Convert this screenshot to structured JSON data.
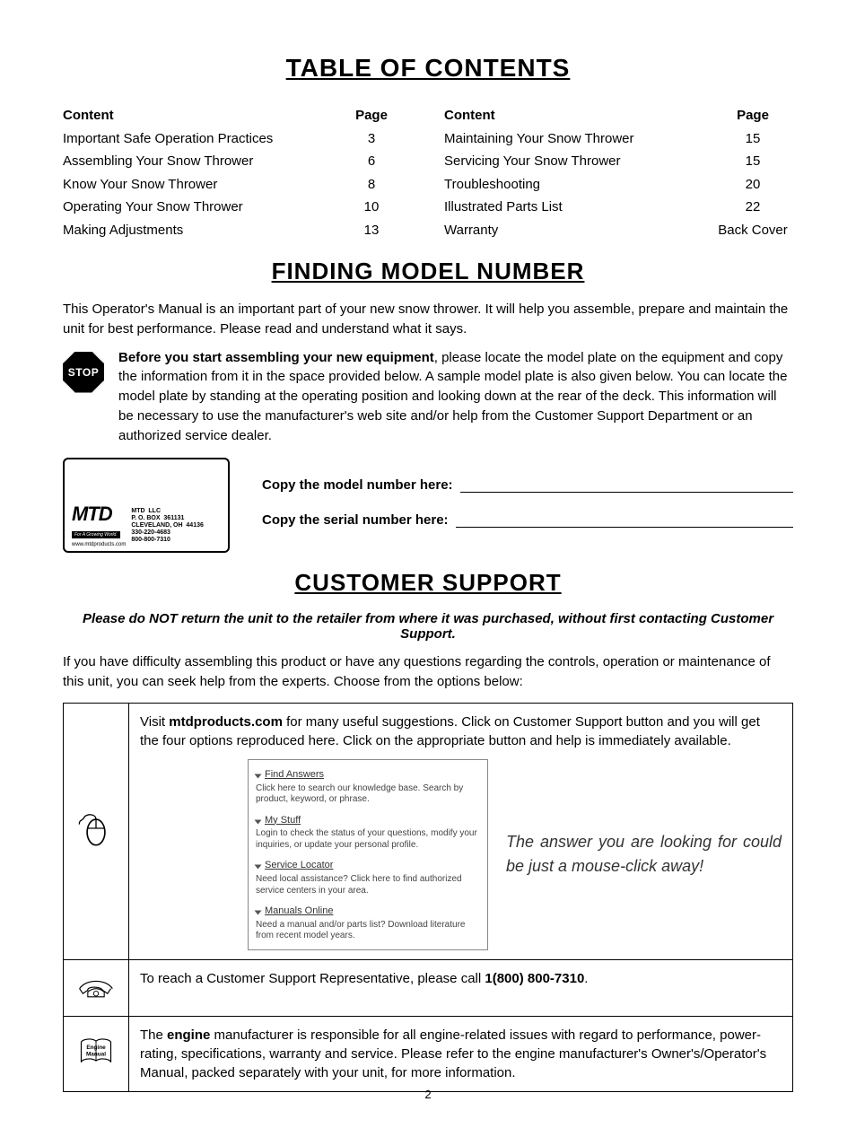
{
  "headings": {
    "toc": "TABLE OF CONTENTS",
    "model": "FINDING MODEL NUMBER",
    "support": "CUSTOMER SUPPORT"
  },
  "toc_header": {
    "content": "Content",
    "page": "Page"
  },
  "toc_left": [
    {
      "label": "Important Safe Operation Practices",
      "page": "3"
    },
    {
      "label": "Assembling Your Snow Thrower",
      "page": "6"
    },
    {
      "label": "Know Your Snow Thrower",
      "page": "8"
    },
    {
      "label": "Operating Your Snow Thrower",
      "page": "10"
    },
    {
      "label": "Making Adjustments",
      "page": "13"
    }
  ],
  "toc_right": [
    {
      "label": "Maintaining Your Snow Thrower",
      "page": "15"
    },
    {
      "label": "Servicing Your Snow Thrower",
      "page": "15"
    },
    {
      "label": "Troubleshooting",
      "page": "20"
    },
    {
      "label": "Illustrated Parts List",
      "page": "22"
    },
    {
      "label": "Warranty",
      "page": "Back Cover"
    }
  ],
  "model": {
    "intro": "This Operator's Manual is an important part of your new snow thrower. It will help you assemble, prepare and maintain the unit for best performance. Please read and understand what it says.",
    "stop_label": "STOP",
    "stop_text_bold": "Before you start assembling your new equipment",
    "stop_text_rest": ", please locate the model plate on the equipment and copy the information from it in the space provided below. A sample model plate is also given below. You can locate the model plate by standing at the operating position and looking down at the rear of the deck. This information will be necessary to use the manufacturer's web site and/or help from the Customer Support Department or an authorized service dealer.",
    "copy_model": "Copy the model number here:",
    "copy_serial": "Copy the serial number here:",
    "plate": {
      "brand": "MTD",
      "tag": "For A Growing World.",
      "url": "www.mtdproducts.com",
      "addr": "MTD  LLC\nP. O. BOX  361131\nCLEVELAND, OH  44136\n330-220-4683\n800-800-7310"
    }
  },
  "support": {
    "warn": "Please do NOT return the unit to the retailer from where it was purchased, without first contacting Customer Support.",
    "intro": "If you have difficulty assembling this product or have any questions regarding the controls, operation or maintenance of this unit, you can seek help from the experts. Choose from the options below:",
    "web_pre": "Visit ",
    "web_site": "mtdproducts.com",
    "web_post": " for many useful suggestions. Click on Customer Support button and you will get the four options reproduced here. Click on the appropriate button and help is immediately available.",
    "answer_callout": "The answer you are looking for could be just a mouse-click away!",
    "options": {
      "find": {
        "title": "Find Answers",
        "desc": "Click here to search our knowledge base. Search by product, keyword, or phrase."
      },
      "mystuff": {
        "title": "My Stuff",
        "desc": "Login to check the status of your questions, modify your inquiries, or update your personal profile."
      },
      "locator": {
        "title": "Service Locator",
        "desc": "Need local assistance? Click here to find authorized service centers in your area."
      },
      "manuals": {
        "title": "Manuals Online",
        "desc": "Need a manual and/or parts list? Download literature from recent model years."
      }
    },
    "phone_pre": "To reach a Customer Support Representative, please call ",
    "phone_num": "1(800) 800-7310",
    "phone_post": ".",
    "engine_icon_label": "Engine\nManual",
    "engine_pre": "The ",
    "engine_bold": "engine",
    "engine_post": " manufacturer is responsible for all engine-related issues with regard to performance, power-rating, specifications, warranty and service. Please refer to the engine manufacturer's Owner's/Operator's Manual, packed separately with your unit, for more information."
  },
  "footer_page": "2"
}
